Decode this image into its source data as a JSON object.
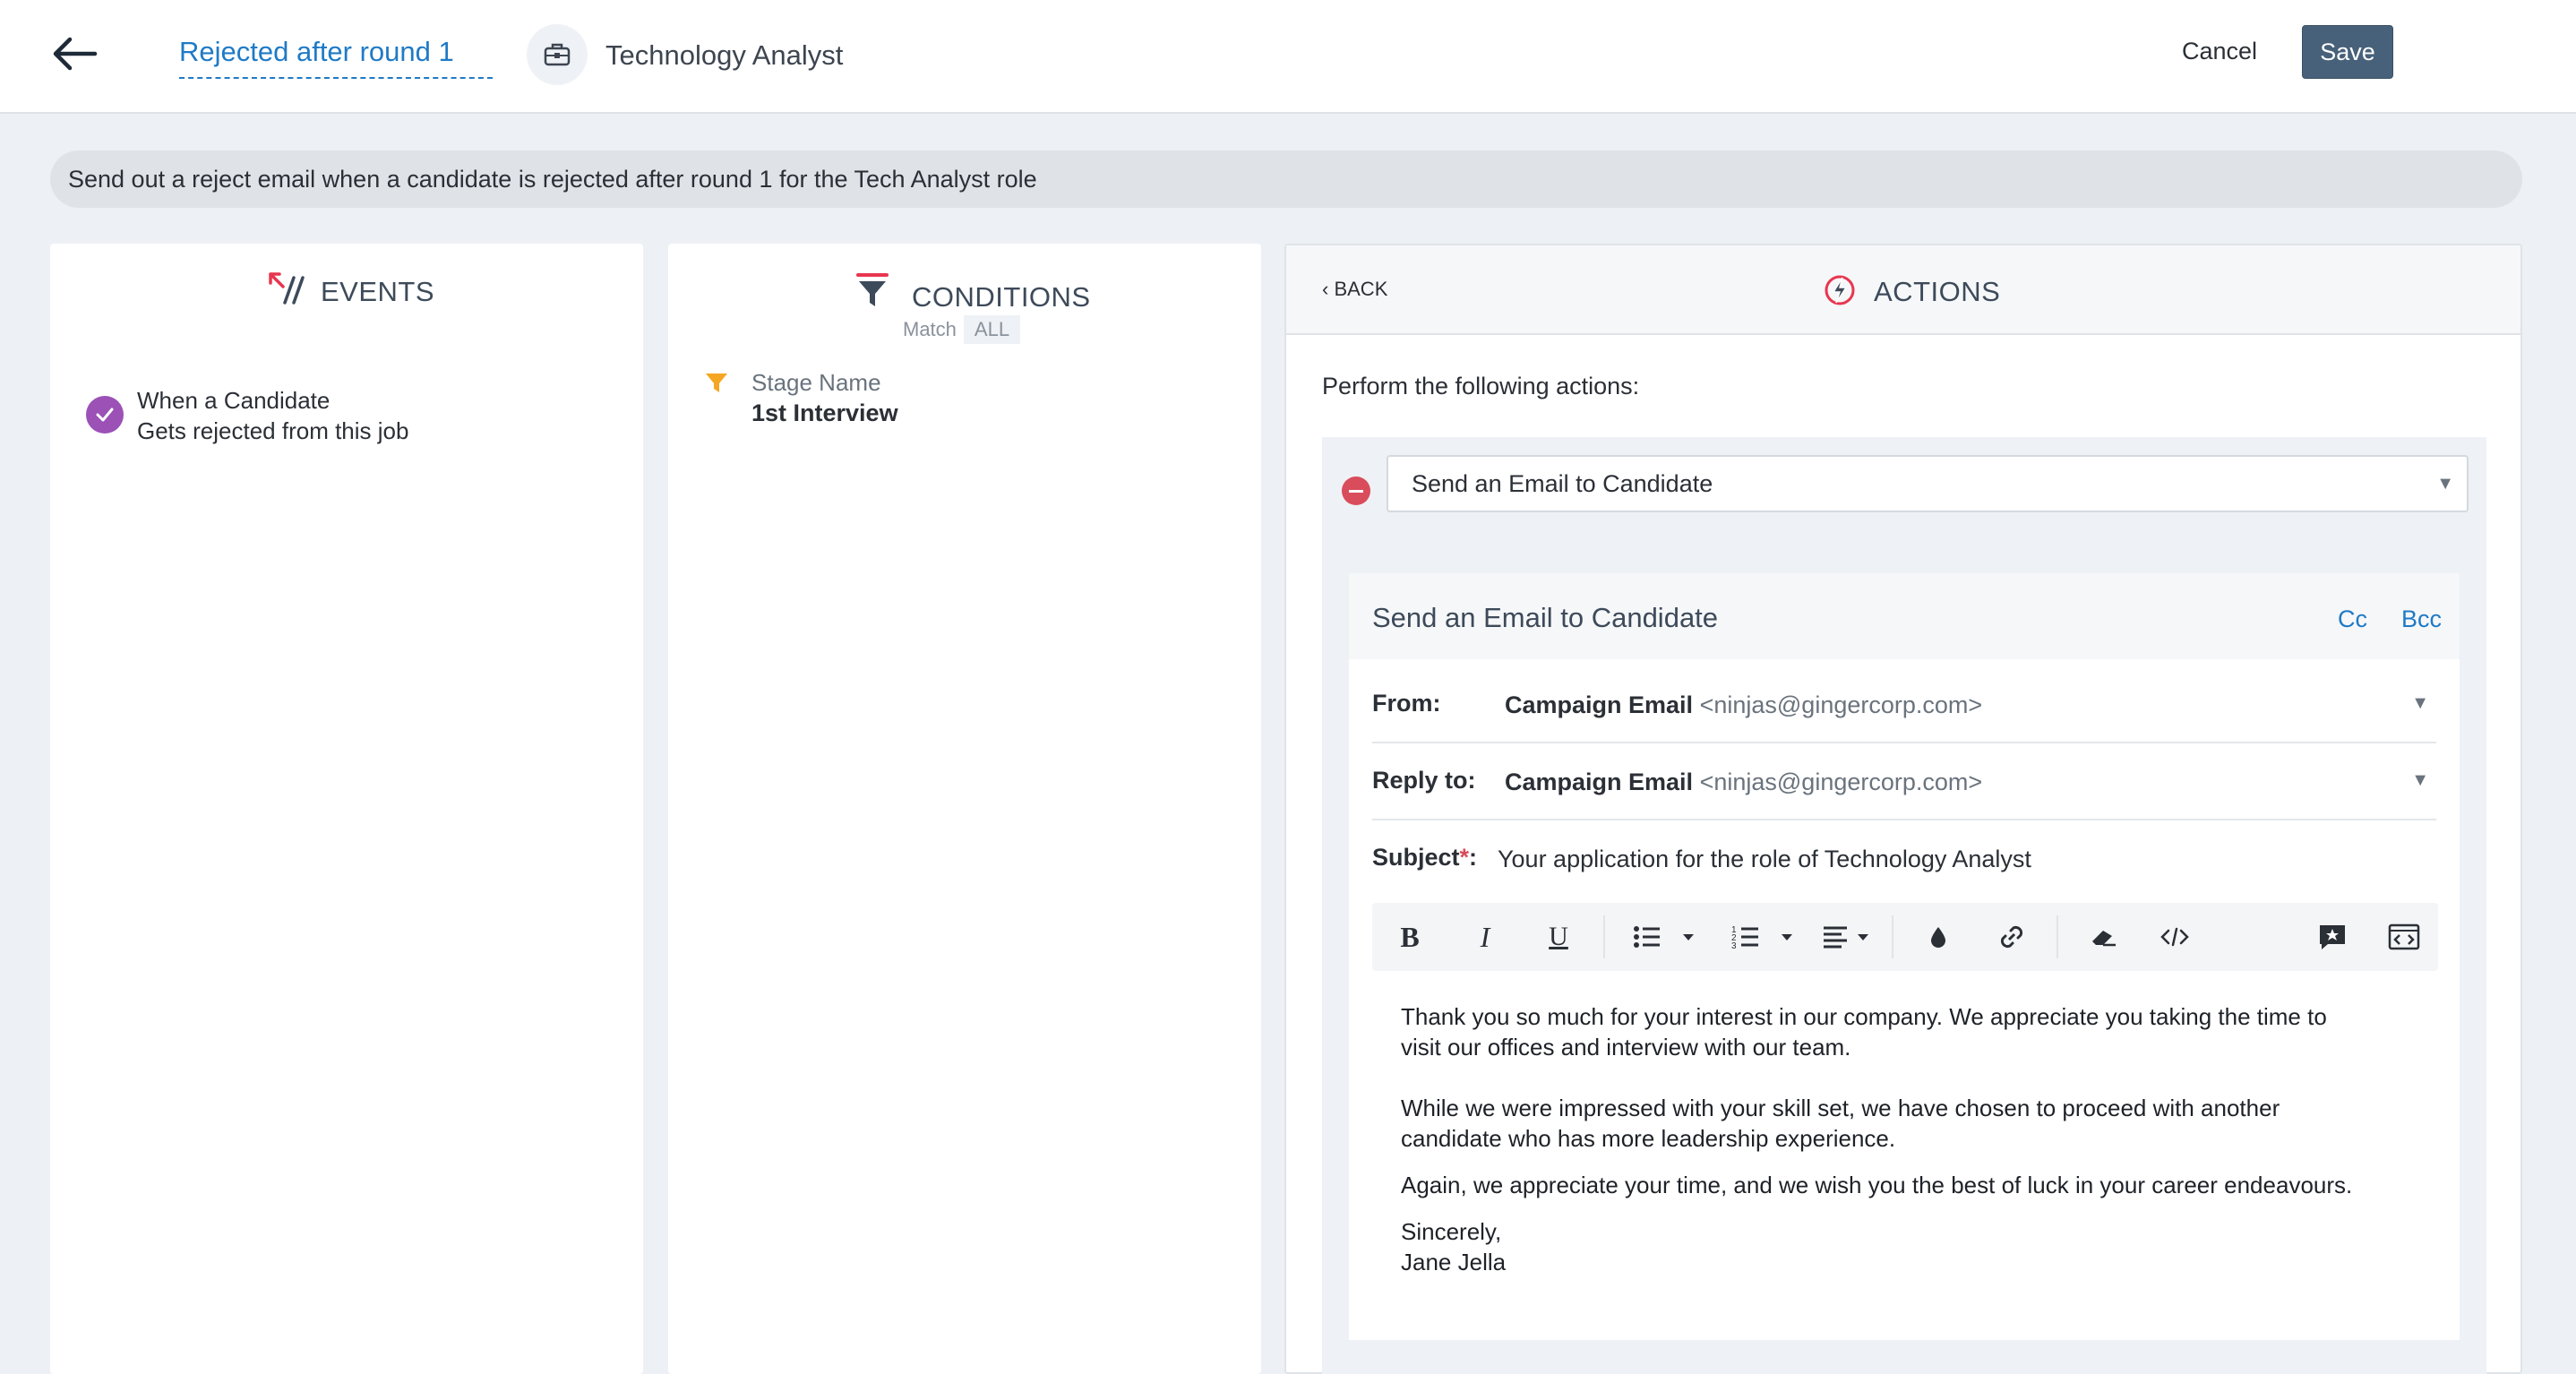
{
  "header": {
    "rule_name": "Rejected after round 1",
    "job_title": "Technology Analyst",
    "cancel_label": "Cancel",
    "save_label": "Save"
  },
  "description": "Send out a reject email when a candidate is rejected after round 1 for the Tech Analyst role",
  "events": {
    "title": "EVENTS",
    "items": [
      {
        "line1": "When a Candidate",
        "line2": "Gets rejected from this job"
      }
    ]
  },
  "conditions": {
    "title": "CONDITIONS",
    "match_label": "Match",
    "match_value": "ALL",
    "items": [
      {
        "label": "Stage Name",
        "value": "1st Interview"
      }
    ]
  },
  "actions": {
    "back_label": "BACK",
    "title": "ACTIONS",
    "perform_label": "Perform the following actions:",
    "selected_action": "Send an Email to Candidate",
    "email": {
      "title": "Send an Email to Candidate",
      "cc_label": "Cc",
      "bcc_label": "Bcc",
      "from_label": "From:",
      "from_name": "Campaign Email",
      "from_address": "<ninjas@gingercorp.com>",
      "reply_label": "Reply to:",
      "reply_name": "Campaign Email",
      "reply_address": "<ninjas@gingercorp.com>",
      "subject_label": "Subject",
      "subject_required": "*",
      "subject_suffix": ":",
      "subject_value": "Your application for the role of Technology Analyst",
      "body": [
        "Thank you so much for your interest in our company. We appreciate you taking the time to",
        "visit our offices and interview with our team.",
        "While we were impressed with your skill set, we have chosen to proceed with another",
        "candidate who has more leadership experience.",
        "Again, we appreciate your time, and we wish you the best of luck in your career endeavours.",
        "Sincerely,",
        "Jane Jella"
      ]
    }
  },
  "toolbar_icons": [
    "bold",
    "italic",
    "underline",
    "bullet-list",
    "numbered-list",
    "align",
    "text-color",
    "link",
    "eraser",
    "code",
    "star-comment",
    "code-view"
  ],
  "colors": {
    "accent": "#1f7ac6",
    "save_button": "#47617a",
    "check": "#9b51b6",
    "remove": "#d94c5c",
    "filter": "#f5a623",
    "events_icon": "#e8364f"
  }
}
